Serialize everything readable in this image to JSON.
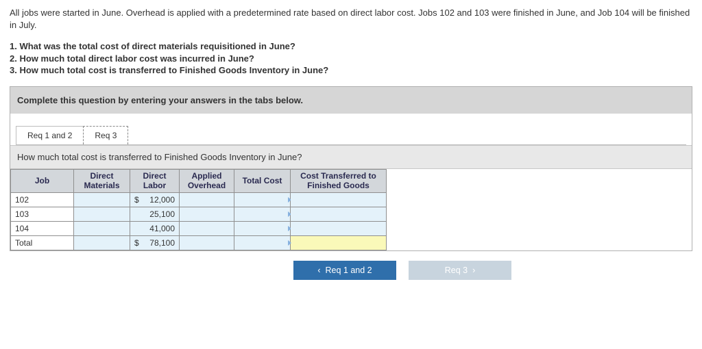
{
  "intro": "All jobs were started in June. Overhead is applied with a predetermined rate based on direct labor cost. Jobs 102 and 103 were finished in June, and Job 104 will be finished in July.",
  "questions": {
    "q1": "1. What was the total cost of direct materials requisitioned in June?",
    "q2": "2. How much total direct labor cost was incurred in June?",
    "q3": "3. How much total cost is transferred to Finished Goods Inventory in June?"
  },
  "instruction": "Complete this question by entering your answers in the tabs below.",
  "tabs": {
    "tab1": "Req 1 and 2",
    "tab2": "Req 3"
  },
  "panel_question": "How much total cost is transferred to Finished Goods Inventory in June?",
  "table": {
    "headers": {
      "job": "Job",
      "dm": "Direct\nMaterials",
      "dl": "Direct\nLabor",
      "ao": "Applied\nOverhead",
      "tc": "Total Cost",
      "cfg": "Cost Transferred to\nFinished Goods"
    },
    "rows": [
      {
        "job": "102",
        "dl_sym": "$",
        "dl_val": "12,000"
      },
      {
        "job": "103",
        "dl_sym": "",
        "dl_val": "25,100"
      },
      {
        "job": "104",
        "dl_sym": "",
        "dl_val": "41,000"
      },
      {
        "job": "Total",
        "dl_sym": "$",
        "dl_val": "78,100"
      }
    ]
  },
  "nav": {
    "prev": "Req 1 and 2",
    "next": "Req 3"
  },
  "glyphs": {
    "chev_left": "‹",
    "chev_right": "›"
  }
}
